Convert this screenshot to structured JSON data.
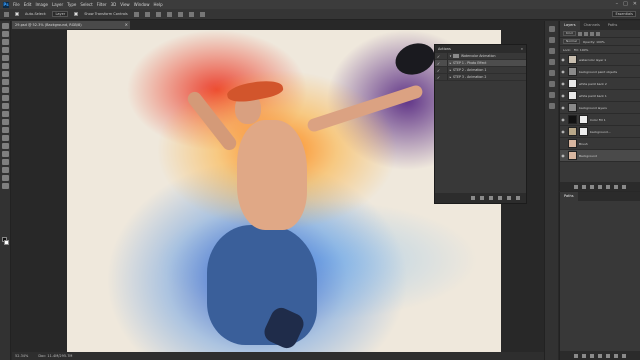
{
  "app": {
    "logo": "Ps"
  },
  "menu": [
    "File",
    "Edit",
    "Image",
    "Layer",
    "Type",
    "Select",
    "Filter",
    "3D",
    "View",
    "Window",
    "Help"
  ],
  "window_controls": [
    "–",
    "□",
    "✕"
  ],
  "options_bar": {
    "auto_select_label": "Auto-Select:",
    "auto_select_value": "Layer",
    "show_transform_label": "Show Transform Controls",
    "right_field": "Essentials"
  },
  "document": {
    "tab_title": "29.psd @ 52.3% (Background, RGB/8)",
    "close_glyph": "×",
    "zoom": "52.34%",
    "doc_info": "Doc: 11.4M/295.7M"
  },
  "actions_panel": {
    "title": "Actions",
    "close_glyph": "»",
    "rows": [
      {
        "label": "Watercolor Animation",
        "check": "✓",
        "arrow": "▾",
        "folder": true,
        "selected": false
      },
      {
        "label": "STEP 1 - Photo Effect",
        "check": "✓",
        "arrow": "▸",
        "folder": false,
        "selected": true
      },
      {
        "label": "STEP 2 - Animation 1",
        "check": "✓",
        "arrow": "▸",
        "folder": false,
        "selected": false
      },
      {
        "label": "STEP 3 - Animation 2",
        "check": "✓",
        "arrow": "▸",
        "folder": false,
        "selected": false
      }
    ]
  },
  "layers_panel": {
    "tabs": [
      "Layers",
      "Channels",
      "Paths"
    ],
    "filter_kind": "Kind",
    "blend_mode": "Normal",
    "opacity_label": "Opacity: 100%",
    "lock_label": "Lock:",
    "fill_label": "Fill: 100%",
    "layers": [
      {
        "name": "watercolor layer 1",
        "visible": "◉",
        "thumb_color": "#c9bfb0",
        "selected": false
      },
      {
        "name": "background paint objects",
        "visible": "◉",
        "thumb_color": "#8a8a8a",
        "selected": false
      },
      {
        "name": "white paint back 2",
        "visible": "◉",
        "thumb_color": "#e8e8e8",
        "selected": false
      },
      {
        "name": "white paint back 1",
        "visible": "◉",
        "thumb_color": "#e8e8e8",
        "selected": false
      },
      {
        "name": "background layers",
        "visible": "◉",
        "thumb_color": "#8a8a8a",
        "selected": false
      },
      {
        "name": "Color Fill 1",
        "visible": "◉",
        "thumb_color": "#111111",
        "selected": false
      },
      {
        "name": "background...",
        "visible": "◉",
        "thumb_color": "#b9a88a",
        "selected": false
      },
      {
        "name": "Brush",
        "visible": "",
        "thumb_color": "#d8b6a0",
        "selected": false
      },
      {
        "name": "Background",
        "visible": "◉",
        "thumb_color": "#d8b6a0",
        "selected": true
      }
    ]
  },
  "paths_panel": {
    "tabs": [
      "Paths"
    ]
  }
}
